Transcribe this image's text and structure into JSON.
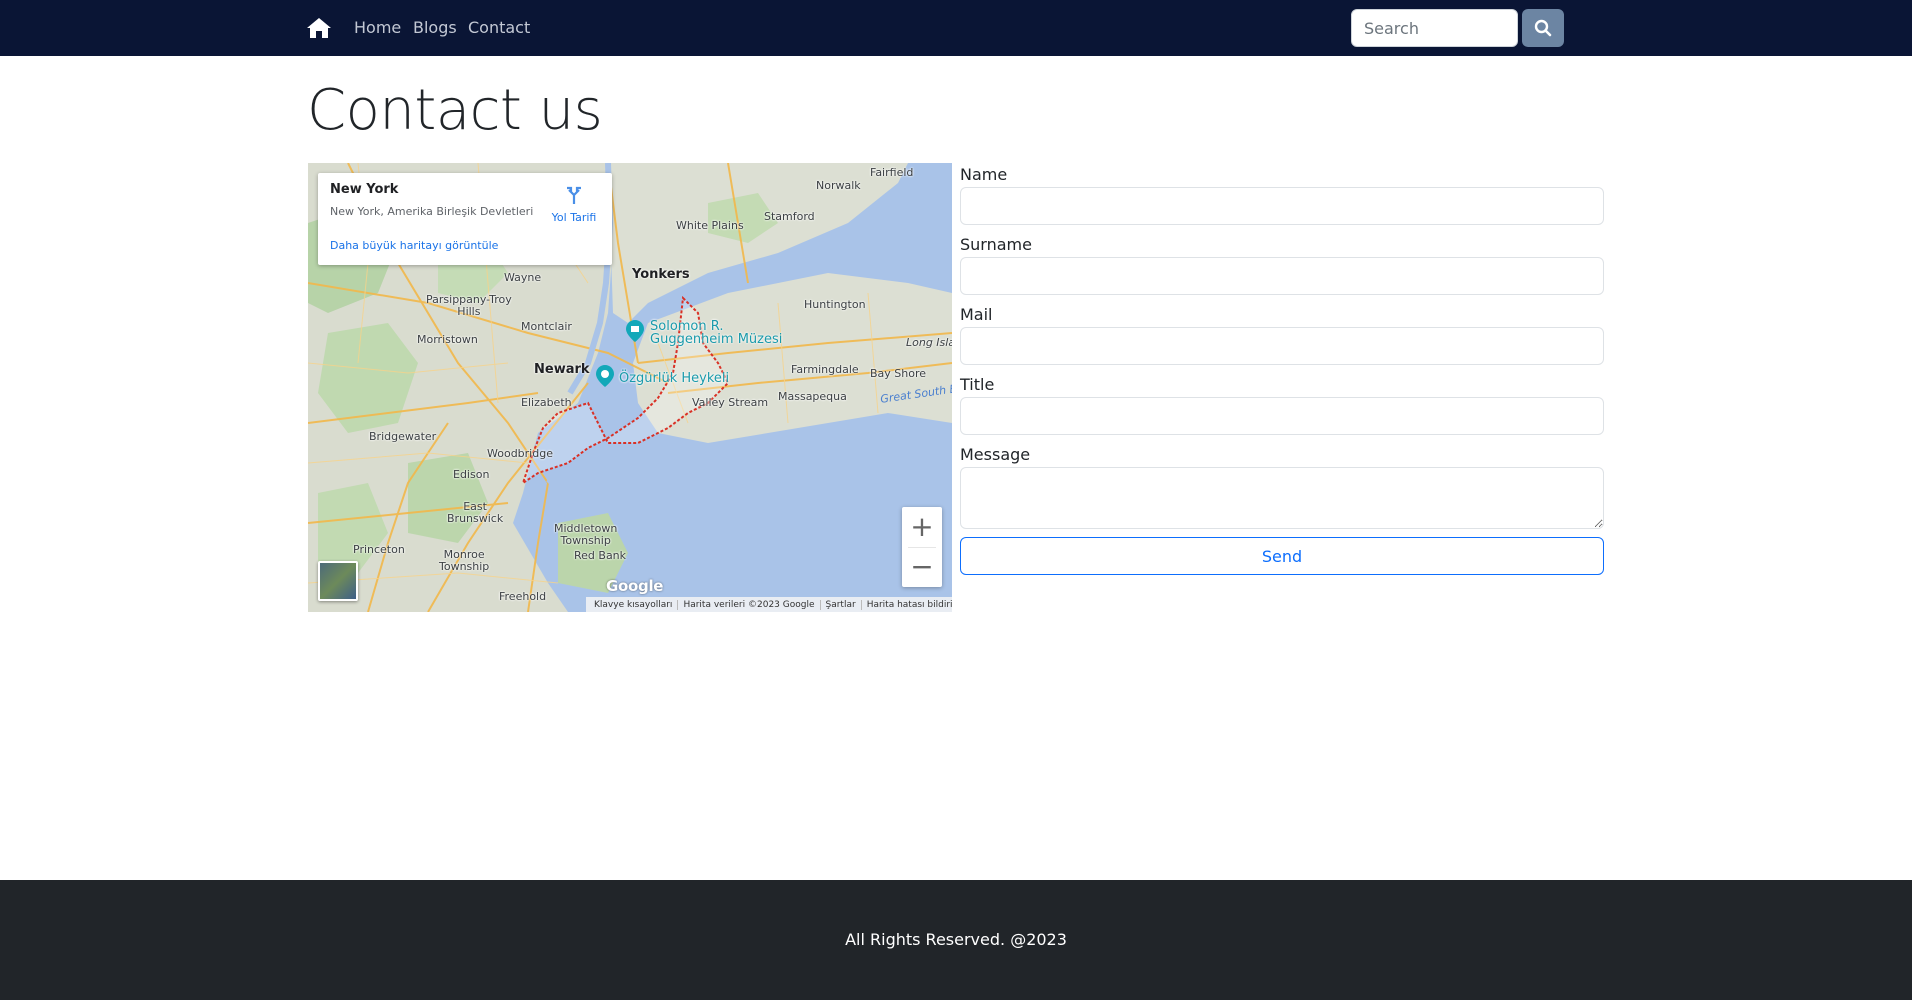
{
  "navbar": {
    "home_icon": "house-icon",
    "links": [
      "Home",
      "Blogs",
      "Contact"
    ],
    "search_placeholder": "Search",
    "search_icon": "magnifier-icon"
  },
  "page": {
    "title": "Contact us"
  },
  "map": {
    "card": {
      "title": "New York",
      "address": "New York, Amerika Birleşik Devletleri",
      "directions_label": "Yol Tarifi",
      "larger_map_link": "Daha büyük haritayı görüntüle"
    },
    "labels": {
      "fairfield": "Fairfield",
      "norwalk": "Norwalk",
      "white_plains": "White Plains",
      "stamford": "Stamford",
      "yonkers": "Yonkers",
      "wayne": "Wayne",
      "parsippany": "Parsippany-Troy\nHills",
      "huntington": "Huntington",
      "morristown": "Morristown",
      "montclair": "Montclair",
      "guggenheim": "Solomon R.\nGuggenheim Müzesi",
      "long_island": "Long Isla",
      "newark": "Newark",
      "farmingdale": "Farmingdale",
      "bay_shore": "Bay Shore",
      "statue": "Özgürlük Heykeli",
      "elizabeth": "Elizabeth",
      "valley_stream": "Valley Stream",
      "massapequa": "Massapequa",
      "great_south_bay": "Great South Ba",
      "bridgewater": "Bridgewater",
      "woodbridge": "Woodbridge",
      "edison": "Edison",
      "east_brunswick": "East\nBrunswick",
      "middletown": "Middletown\nTownship",
      "princeton": "Princeton",
      "monroe": "Monroe\nTownship",
      "red_bank": "Red Bank",
      "freehold": "Freehold"
    },
    "google_logo": "Google",
    "attribution": [
      "Klavye kısayolları",
      "Harita verileri ©2023 Google",
      "Şartlar",
      "Harita hatası bildirin"
    ],
    "zoom_in": "+",
    "zoom_out": "−"
  },
  "form": {
    "fields": [
      {
        "label": "Name",
        "value": ""
      },
      {
        "label": "Surname",
        "value": ""
      },
      {
        "label": "Mail",
        "value": ""
      },
      {
        "label": "Title",
        "value": ""
      }
    ],
    "message_label": "Message",
    "message_value": "",
    "send_label": "Send"
  },
  "footer": {
    "text": "All Rights Reserved. @2023"
  },
  "colors": {
    "navbar_bg": "#0a1535",
    "search_btn": "#6c85a3",
    "primary": "#0d6efd",
    "footer_bg": "#212529"
  }
}
